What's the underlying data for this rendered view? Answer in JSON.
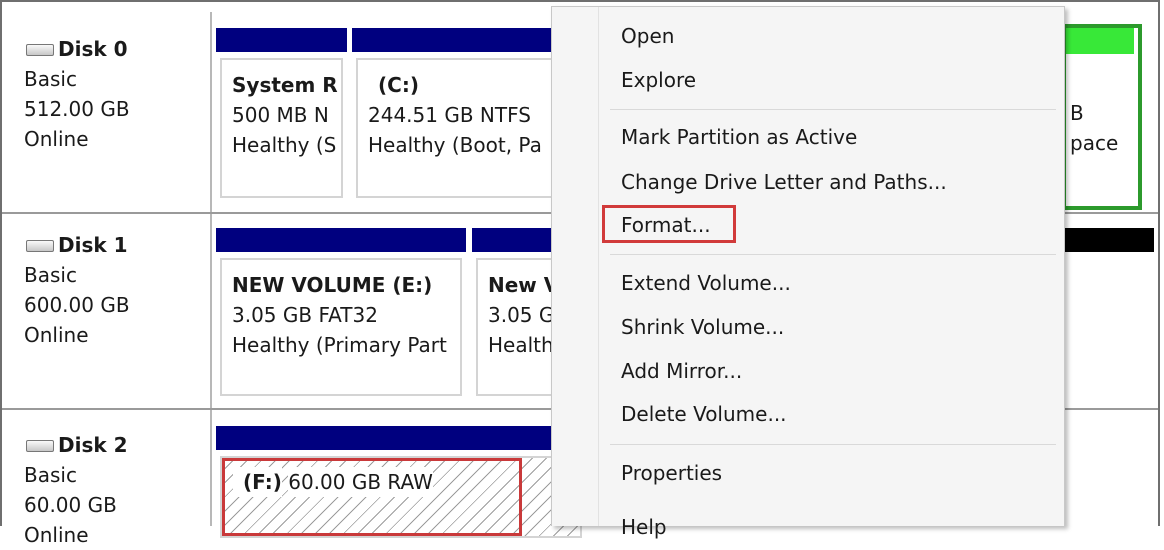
{
  "disks": [
    {
      "name": "Disk 0",
      "type": "Basic",
      "size": "512.00 GB",
      "status": "Online"
    },
    {
      "name": "Disk 1",
      "type": "Basic",
      "size": "600.00 GB",
      "status": "Online"
    },
    {
      "name": "Disk 2",
      "type": "Basic",
      "size": "60.00 GB",
      "status": "Online"
    }
  ],
  "partitions": {
    "d0_system": {
      "title": "System R",
      "line1": "500 MB N",
      "line2": "Healthy (S"
    },
    "d0_c": {
      "title": "(C:)",
      "line1": "244.51 GB NTFS",
      "line2": "Healthy (Boot, Pa"
    },
    "d0_right": {
      "line1": "B",
      "line2": "pace"
    },
    "d1_e": {
      "title": "NEW VOLUME  (E:)",
      "line1": "3.05 GB FAT32",
      "line2": "Healthy (Primary Part"
    },
    "d1_new": {
      "title": "New V",
      "line1": "3.05 G",
      "line2": "Health"
    },
    "d2_f": {
      "title": "(F:)",
      "line1": "60.00 GB RAW"
    }
  },
  "menu": {
    "open": "Open",
    "explore": "Explore",
    "mark_active": "Mark Partition as Active",
    "change_letter": "Change Drive Letter and Paths...",
    "format": "Format...",
    "extend": "Extend Volume...",
    "shrink": "Shrink Volume...",
    "add_mirror": "Add Mirror...",
    "delete": "Delete Volume...",
    "properties": "Properties",
    "help": "Help"
  },
  "colors": {
    "partition_bar": "#00007f",
    "unallocated_bar": "#000000",
    "free_space_bar": "#38e838",
    "highlight": "#d13a3a"
  }
}
